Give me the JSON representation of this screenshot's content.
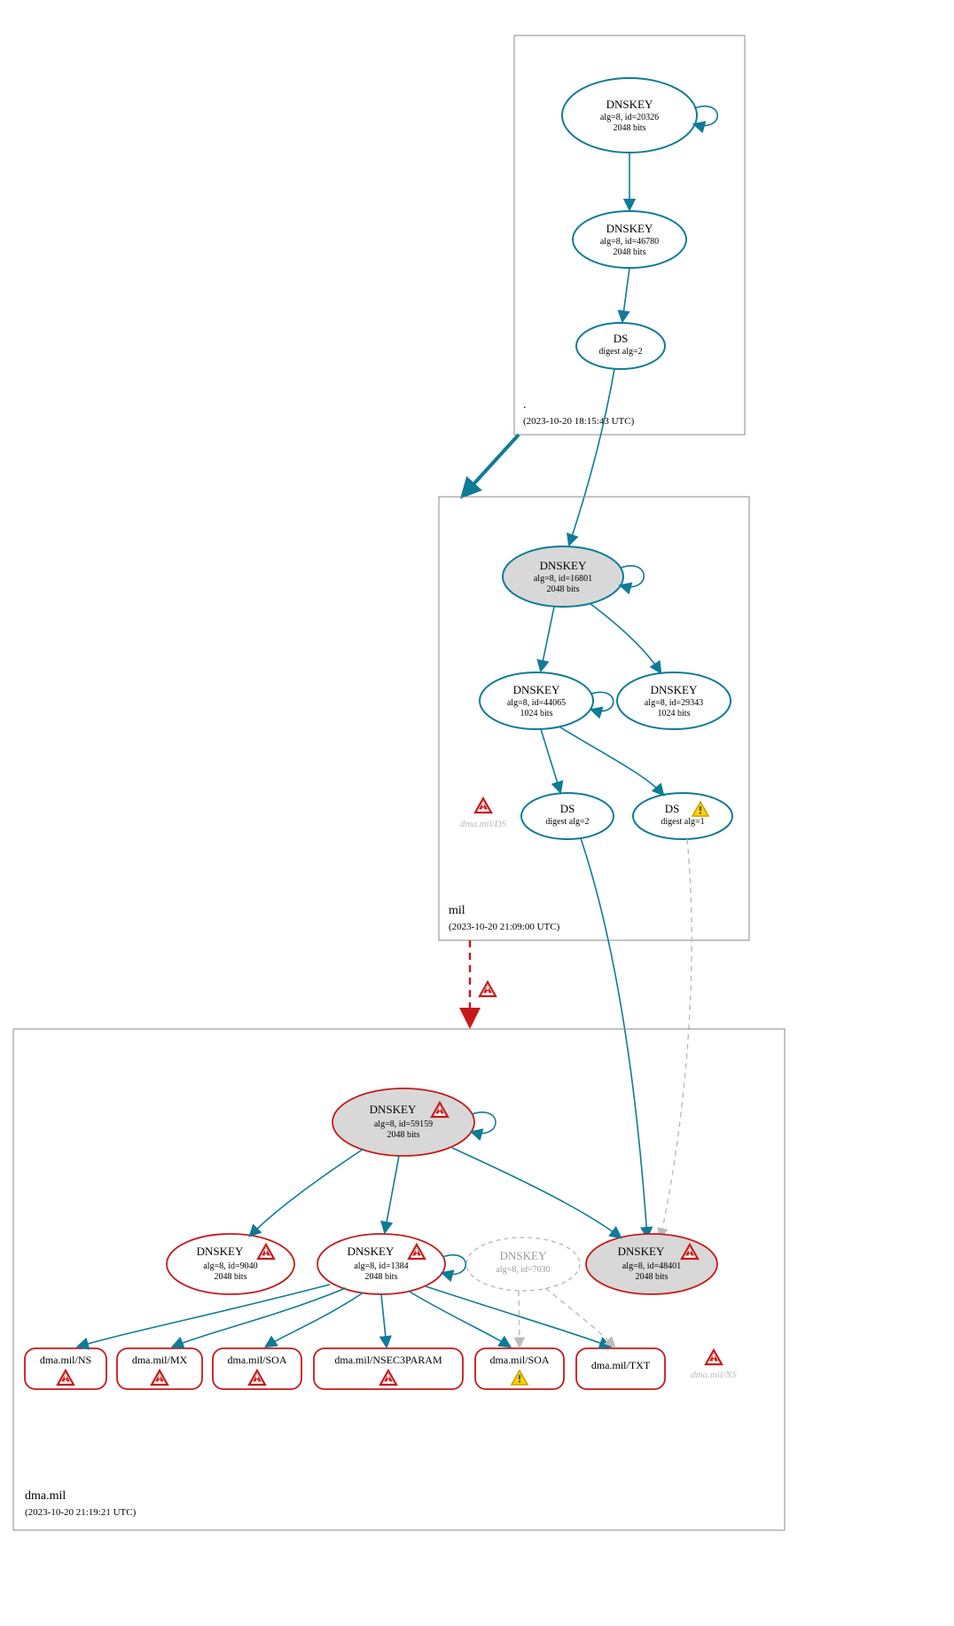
{
  "zones": {
    "root": {
      "label": ".",
      "timestamp": "(2023-10-20 18:15:43 UTC)"
    },
    "mil": {
      "label": "mil",
      "timestamp": "(2023-10-20 21:09:00 UTC)"
    },
    "dmamil": {
      "label": "dma.mil",
      "timestamp": "(2023-10-20 21:19:21 UTC)"
    }
  },
  "nodes": {
    "root_ksk": {
      "title": "DNSKEY",
      "l1": "alg=8, id=20326",
      "l2": "2048 bits"
    },
    "root_zsk": {
      "title": "DNSKEY",
      "l1": "alg=8, id=46780",
      "l2": "2048 bits"
    },
    "root_ds": {
      "title": "DS",
      "l1": "digest alg=2"
    },
    "mil_ksk": {
      "title": "DNSKEY",
      "l1": "alg=8, id=16801",
      "l2": "2048 bits"
    },
    "mil_zsk1": {
      "title": "DNSKEY",
      "l1": "alg=8, id=44065",
      "l2": "1024 bits"
    },
    "mil_zsk2": {
      "title": "DNSKEY",
      "l1": "alg=8, id=29343",
      "l2": "1024 bits"
    },
    "mil_ds1": {
      "title": "DS",
      "l1": "digest alg=2"
    },
    "mil_ds2": {
      "title": "DS",
      "l1": "digest alg=1"
    },
    "mil_ghost": {
      "label": "dma.mil/DS"
    },
    "dma_ksk": {
      "title": "DNSKEY",
      "l1": "alg=8, id=59159",
      "l2": "2048 bits"
    },
    "dma_k9040": {
      "title": "DNSKEY",
      "l1": "alg=8, id=9040",
      "l2": "2048 bits"
    },
    "dma_k1384": {
      "title": "DNSKEY",
      "l1": "alg=8, id=1384",
      "l2": "2048 bits"
    },
    "dma_k7030": {
      "title": "DNSKEY",
      "l1": "alg=8, id=7030"
    },
    "dma_k48401": {
      "title": "DNSKEY",
      "l1": "alg=8, id=48401",
      "l2": "2048 bits"
    },
    "rr_ns": {
      "label": "dma.mil/NS"
    },
    "rr_mx": {
      "label": "dma.mil/MX"
    },
    "rr_soa1": {
      "label": "dma.mil/SOA"
    },
    "rr_n3p": {
      "label": "dma.mil/NSEC3PARAM"
    },
    "rr_soa2": {
      "label": "dma.mil/SOA"
    },
    "rr_txt": {
      "label": "dma.mil/TXT"
    },
    "ghost_ns": {
      "label": "dma.mil/NS"
    }
  },
  "icons": {
    "error": "error-icon",
    "warn": "warn-icon"
  }
}
